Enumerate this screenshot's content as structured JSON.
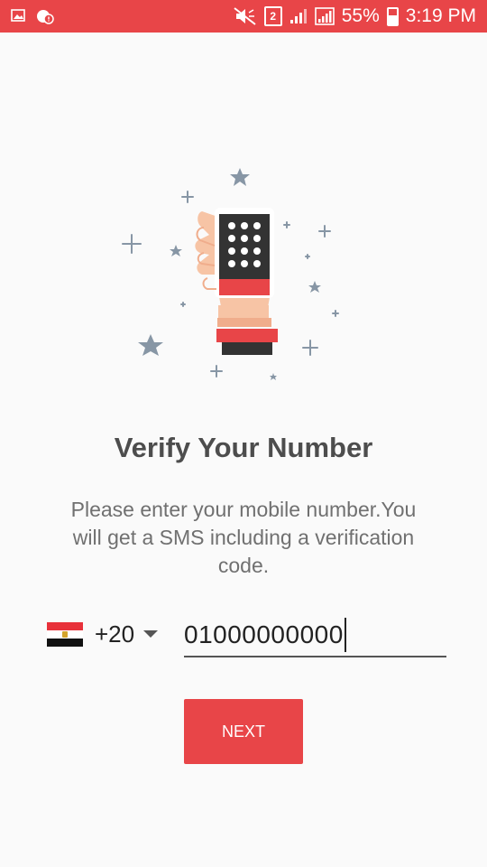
{
  "status_bar": {
    "sim_slot": "2",
    "battery": "55%",
    "time": "3:19 PM",
    "icons": [
      "image-icon",
      "notification-icon",
      "mute-icon",
      "sim-icon",
      "signal-icon",
      "signal-2-icon",
      "battery-icon"
    ]
  },
  "illustration": {
    "icon": "phone-keypad-hand-icon"
  },
  "title": "Verify Your Number",
  "subtitle": "Please enter your mobile number.You will get a SMS including a verification code.",
  "country": {
    "flag": "egypt-flag-icon",
    "code": "+20"
  },
  "phone": {
    "value": "01000000000"
  },
  "next_button": {
    "label": "NEXT"
  },
  "colors": {
    "accent": "#e84548",
    "background": "#fafafa"
  }
}
